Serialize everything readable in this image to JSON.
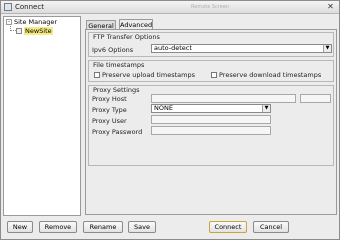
{
  "window": {
    "title": "Connect",
    "watermark": "Remote Screen",
    "close": "✕"
  },
  "tree": {
    "root_label": "Site Manager",
    "root_toggle": "-",
    "child_label": "NewSite"
  },
  "tabs": {
    "general": "General",
    "advanced": "Advanced",
    "active": "Advanced"
  },
  "ftp": {
    "group_title": "FTP Transfer Options",
    "ipv6_label": "Ipv6 Options",
    "ipv6_value": "auto-detect"
  },
  "timestamps": {
    "group_title": "File timestamps",
    "preserve_upload": "Preserve upload timestamps",
    "preserve_download": "Preserve download timestamps",
    "preserve_upload_checked": false,
    "preserve_download_checked": false
  },
  "proxy": {
    "group_title": "Proxy Settings",
    "host_label": "Proxy Host",
    "host_value": "",
    "type_label": "Proxy Type",
    "type_value": "NONE",
    "user_label": "Proxy User",
    "user_value": "",
    "password_label": "Proxy Password",
    "password_value": ""
  },
  "buttons": {
    "new": "New",
    "remove": "Remove",
    "rename": "Rename",
    "save": "Save",
    "connect": "Connect",
    "cancel": "Cancel"
  }
}
